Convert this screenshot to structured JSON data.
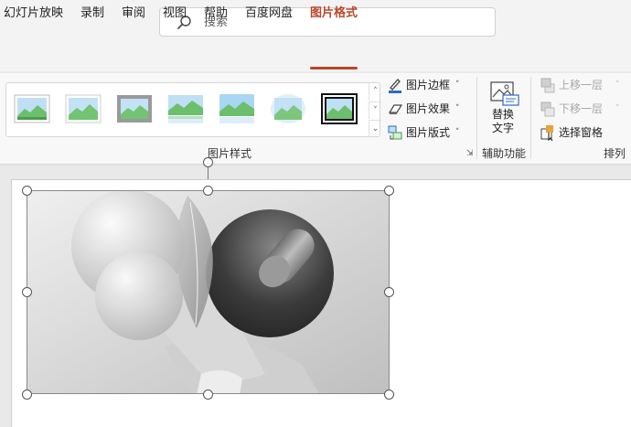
{
  "search": {
    "placeholder": "搜索"
  },
  "tabs": [
    {
      "label": "幻灯片放映",
      "active": false
    },
    {
      "label": "录制",
      "active": false
    },
    {
      "label": "审阅",
      "active": false
    },
    {
      "label": "视图",
      "active": false
    },
    {
      "label": "帮助",
      "active": false
    },
    {
      "label": "百度网盘",
      "active": false
    },
    {
      "label": "图片格式",
      "active": true
    }
  ],
  "ribbon": {
    "picture_styles": {
      "label": "图片样式",
      "gallery_styles": [
        "simple-frame-white",
        "soft-edge-frame",
        "thick-matte-gray",
        "reflected-rounded",
        "soft-edge-glow",
        "soft-edge-oval",
        "double-frame-black"
      ],
      "selected_index": 6
    },
    "picture_border_label": "图片边框",
    "picture_effects_label": "图片效果",
    "picture_layout_label": "图片版式",
    "accessibility": {
      "label": "辅助功能",
      "alt_text_line1": "替换",
      "alt_text_line2": "文字"
    },
    "arrange": {
      "label": "排列",
      "bring_forward_label": "上移一层",
      "send_backward_label": "下移一层",
      "selection_pane_label": "选择窗格"
    }
  },
  "colors": {
    "accent": "#b7472a",
    "disabled_text": "#a7a7a7",
    "border_pen": "#2b6cc4",
    "selection_pane": "#e8a33a"
  }
}
